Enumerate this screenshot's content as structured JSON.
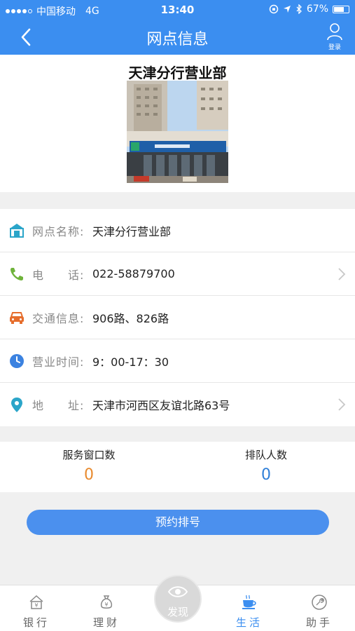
{
  "status_bar": {
    "carrier": "中国移动",
    "network": "4G",
    "time": "13:40",
    "battery_text": "67%",
    "battery_level": 0.67
  },
  "nav": {
    "title": "网点信息",
    "login_label": "登录"
  },
  "branch": {
    "name": "天津分行营业部"
  },
  "info": {
    "items": [
      {
        "label": "网点名称:",
        "value": "天津分行营业部",
        "icon": "bank-icon"
      },
      {
        "label": "电　　话:",
        "value": "022-58879700",
        "icon": "phone-icon"
      },
      {
        "label": "交通信息:",
        "value": "906路、826路",
        "icon": "car-icon"
      },
      {
        "label": "营业时间:",
        "value": "9：00-17：30",
        "icon": "clock-icon"
      },
      {
        "label": "地　　址:",
        "value": "天津市河西区友谊北路63号",
        "icon": "location-icon"
      }
    ]
  },
  "queue": {
    "service_label": "服务窗口数",
    "service_value": "0",
    "waiting_label": "排队人数",
    "waiting_value": "0"
  },
  "reserve_button": "预约排号",
  "tabs": [
    {
      "label": "银行",
      "icon": "bank-house-icon"
    },
    {
      "label": "理财",
      "icon": "money-bag-icon"
    },
    {
      "label": "发现",
      "icon": "eye-icon"
    },
    {
      "label": "生活",
      "icon": "coffee-cup-icon"
    },
    {
      "label": "助手",
      "icon": "wrench-icon"
    }
  ],
  "colors": {
    "primary": "#3b8ef0",
    "orange_value": "#e88a2e",
    "blue_value": "#2f7fd8",
    "icon_orange": "#e66d2c",
    "icon_green": "#6fb33b",
    "icon_teal": "#2ba5c9"
  }
}
